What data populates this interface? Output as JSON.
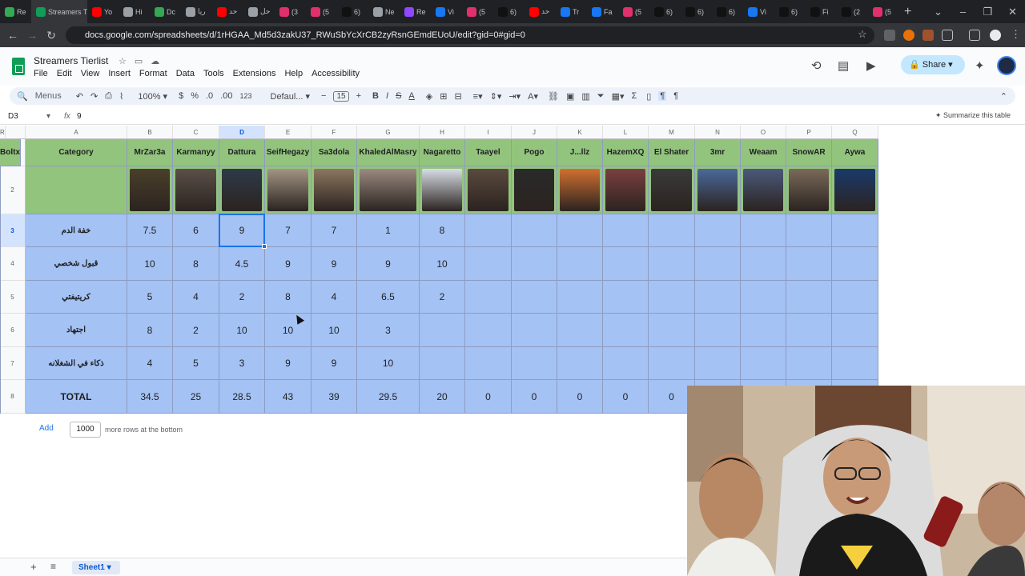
{
  "browser": {
    "tabs": [
      {
        "label": "Re",
        "color": "#34a853",
        "active": false
      },
      {
        "label": "Streamers Tierlist",
        "color": "#0f9d58",
        "active": true
      },
      {
        "label": "Yo",
        "color": "#ff0000",
        "active": false
      },
      {
        "label": "Hi",
        "color": "#9aa0a6",
        "active": false
      },
      {
        "label": "Dc",
        "color": "#34a853",
        "active": false
      },
      {
        "label": "ريا",
        "color": "#9aa0a6",
        "active": false
      },
      {
        "label": "حد",
        "color": "#ff0000",
        "active": false
      },
      {
        "label": "حل",
        "color": "#9aa0a6",
        "active": false
      },
      {
        "label": "(3",
        "color": "#e1306c",
        "active": false
      },
      {
        "label": "(5",
        "color": "#e1306c",
        "active": false
      },
      {
        "label": "6)",
        "color": "#111111",
        "active": false
      },
      {
        "label": "Ne",
        "color": "#9aa0a6",
        "active": false
      },
      {
        "label": "Re",
        "color": "#9146ff",
        "active": false
      },
      {
        "label": "Vi",
        "color": "#1877f2",
        "active": false
      },
      {
        "label": "(5",
        "color": "#e1306c",
        "active": false
      },
      {
        "label": "6)",
        "color": "#111111",
        "active": false
      },
      {
        "label": "حد",
        "color": "#ff0000",
        "active": false
      },
      {
        "label": "Tr",
        "color": "#1877f2",
        "active": false
      },
      {
        "label": "Fa",
        "color": "#1877f2",
        "active": false
      },
      {
        "label": "(5",
        "color": "#e1306c",
        "active": false
      },
      {
        "label": "6)",
        "color": "#111111",
        "active": false
      },
      {
        "label": "6)",
        "color": "#111111",
        "active": false
      },
      {
        "label": "6)",
        "color": "#111111",
        "active": false
      },
      {
        "label": "Vi",
        "color": "#1877f2",
        "active": false
      },
      {
        "label": "6)",
        "color": "#111111",
        "active": false
      },
      {
        "label": "Fi",
        "color": "#111111",
        "active": false
      },
      {
        "label": "(2",
        "color": "#111111",
        "active": false
      },
      {
        "label": "(5",
        "color": "#e1306c",
        "active": false
      }
    ],
    "url": "docs.google.com/spreadsheets/d/1rHGAA_Md5d3zakU37_RWuSbYcXrCB2zyRsnGEmdEUoU/edit?gid=0#gid=0"
  },
  "app": {
    "title": "Streamers Tierlist",
    "menus": [
      "File",
      "Edit",
      "View",
      "Insert",
      "Format",
      "Data",
      "Tools",
      "Extensions",
      "Help",
      "Accessibility"
    ],
    "share_label": "Share"
  },
  "toolbar": {
    "search_label": "Menus",
    "zoom": "100%",
    "currency": "$",
    "percent": "%",
    "dec_decrease": ".0",
    "dec_increase": ".00",
    "number_format": "123",
    "font": "Defaul...",
    "font_size": "15"
  },
  "formula_bar": {
    "cell_ref": "D3",
    "fx": "fx",
    "value": "9",
    "summarize_label": "Summarize this table"
  },
  "columns": [
    "A",
    "B",
    "C",
    "D",
    "E",
    "F",
    "G",
    "H",
    "I",
    "J",
    "K",
    "L",
    "M",
    "N",
    "O",
    "P",
    "Q",
    "R"
  ],
  "row_numbers": [
    "1",
    "2",
    "3",
    "4",
    "5",
    "6",
    "7",
    "8"
  ],
  "sheet": {
    "header_label": "Category",
    "streamers": [
      "MrZar3a",
      "Karmanyy",
      "Dattura",
      "SeifHegazy",
      "Sa3dola",
      "KhaledAlMasry",
      "Nagaretto",
      "Taayel",
      "Pogo",
      "J...llz",
      "HazemXQ",
      "El Shater",
      "3mr",
      "Weaam",
      "SnowAR",
      "Aywa",
      "Boltx"
    ],
    "photo_colors": [
      "#4a3f2a",
      "#5b5048",
      "#2e3a48",
      "#a39584",
      "#8c7660",
      "#9a8a80",
      "#d8dde6",
      "#5a4a3e",
      "#2a2a2a",
      "#d07030",
      "#7a4040",
      "#3a3a3a",
      "#4a6a9a",
      "#4a5a7a",
      "#7a6a5a",
      "#1a3a6a",
      "#b040c0"
    ],
    "rows": [
      {
        "category": "خفة الدم",
        "values": [
          "7.5",
          "6",
          "9",
          "7",
          "7",
          "1",
          "8",
          "",
          "",
          "",
          "",
          "",
          "",
          "",
          "",
          "",
          ""
        ]
      },
      {
        "category": "قبول شخصي",
        "values": [
          "10",
          "8",
          "4.5",
          "9",
          "9",
          "9",
          "10",
          "",
          "",
          "",
          "",
          "",
          "",
          "",
          "",
          "",
          ""
        ]
      },
      {
        "category": "كريتيفتي",
        "values": [
          "5",
          "4",
          "2",
          "8",
          "4",
          "6.5",
          "2",
          "",
          "",
          "",
          "",
          "",
          "",
          "",
          "",
          "",
          ""
        ]
      },
      {
        "category": "اجتهاد",
        "values": [
          "8",
          "2",
          "10",
          "10",
          "10",
          "3",
          "",
          "",
          "",
          "",
          "",
          "",
          "",
          "",
          "",
          "",
          ""
        ]
      },
      {
        "category": "ذكاء في الشغلانه",
        "values": [
          "4",
          "5",
          "3",
          "9",
          "9",
          "10",
          "",
          "",
          "",
          "",
          "",
          "",
          "",
          "",
          "",
          "",
          ""
        ]
      }
    ],
    "total_label": "TOTAL",
    "totals": [
      "34.5",
      "25",
      "28.5",
      "43",
      "39",
      "29.5",
      "20",
      "0",
      "0",
      "0",
      "0",
      "0"
    ]
  },
  "footer": {
    "add_label": "Add",
    "rows_value": "1000",
    "rows_text": "more rows at the bottom",
    "sheet_tab": "Sheet1"
  },
  "colors": {
    "header_green": "#93c47d",
    "body_blue": "#a4c2f4",
    "selection": "#1a73e8"
  }
}
